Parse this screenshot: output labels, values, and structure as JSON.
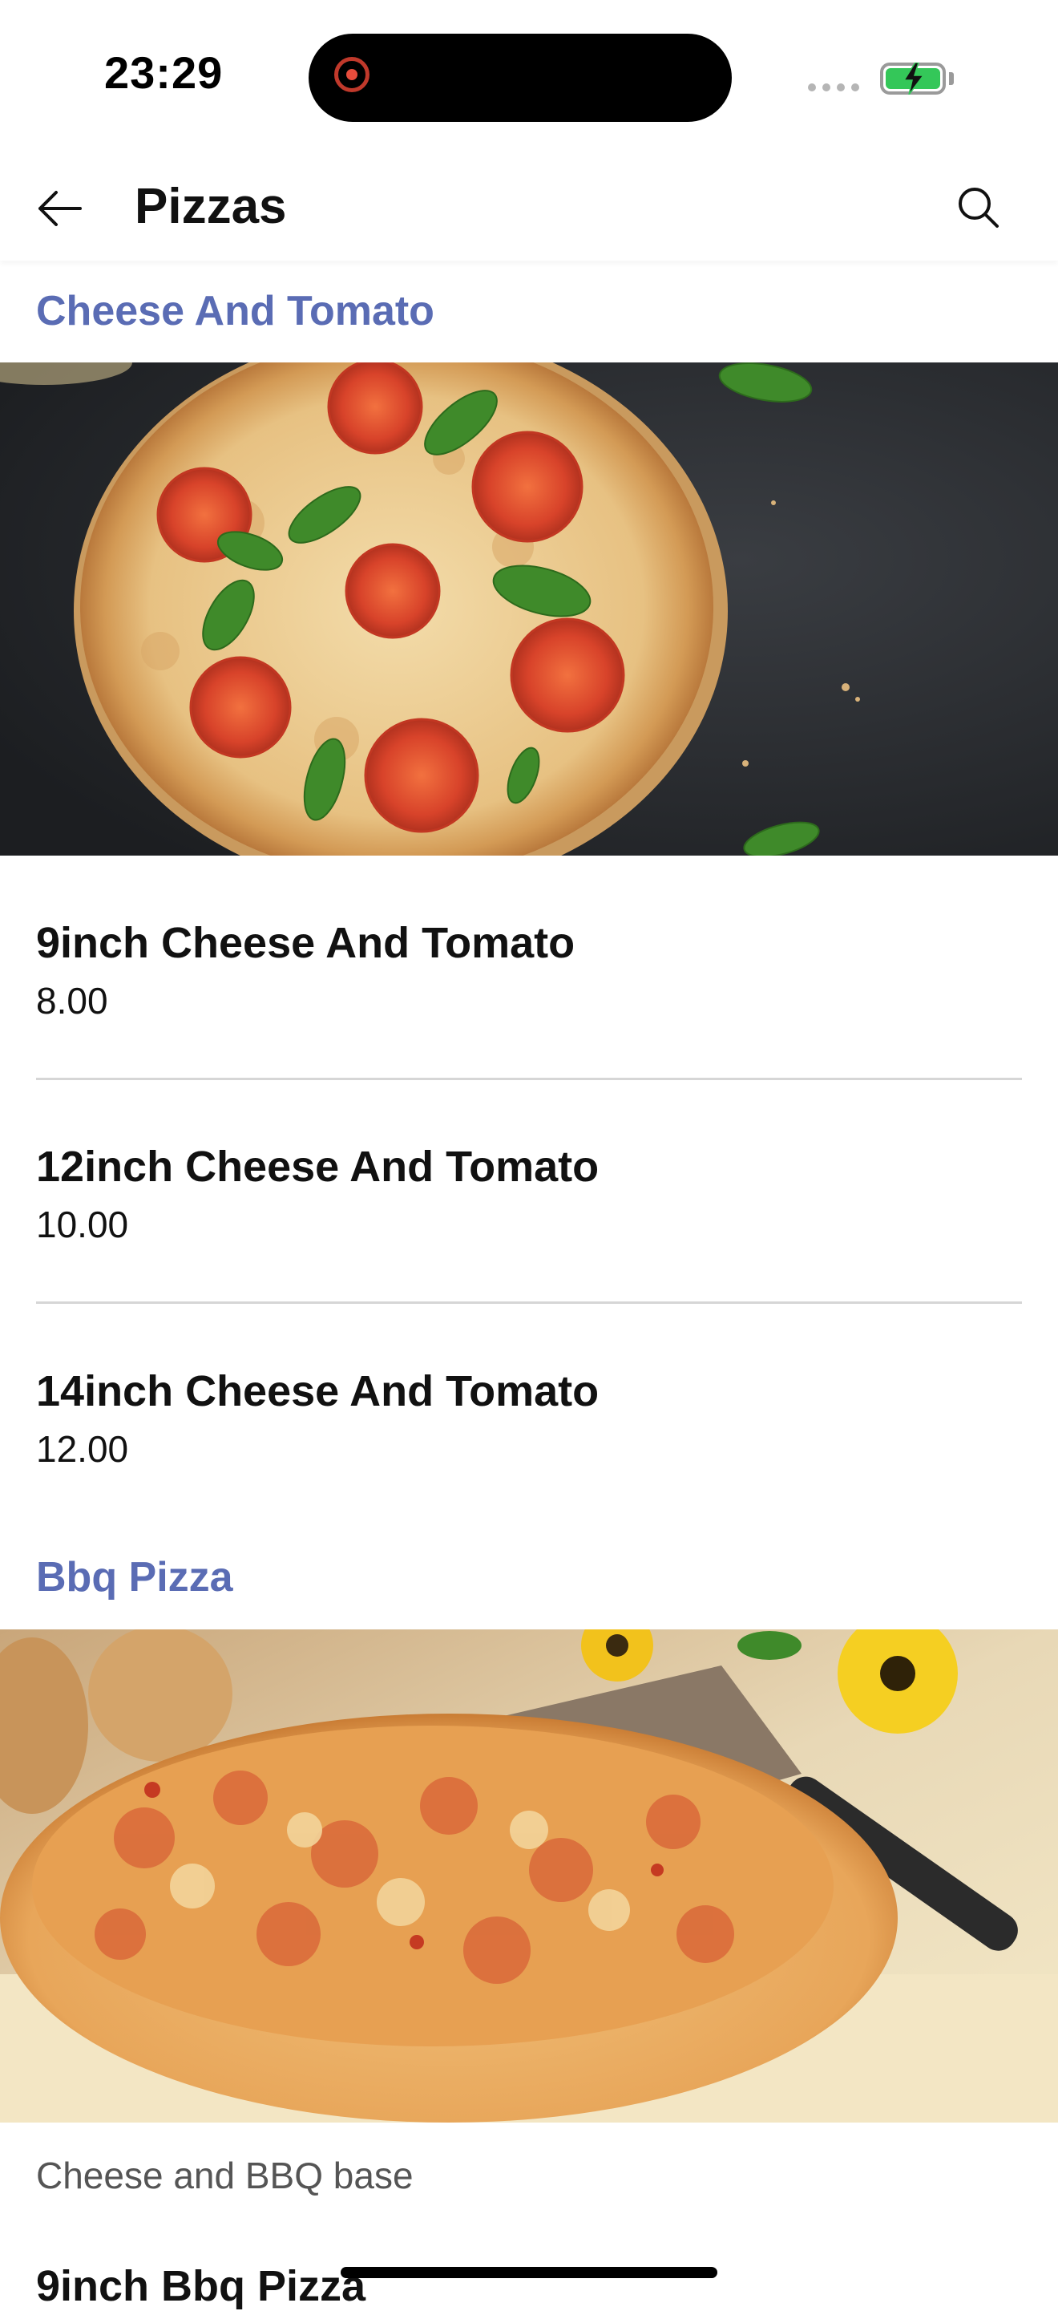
{
  "status_bar": {
    "time": "23:29",
    "battery_color": "#34c759",
    "recording_color": "#e74c3c"
  },
  "header": {
    "title": "Pizzas",
    "back_icon": "arrow-left-icon",
    "search_icon": "search-icon"
  },
  "accent_color": "#5a6cb4",
  "sections": [
    {
      "title": "Cheese And Tomato",
      "image": "cheese-and-tomato-pizza-photo",
      "items": [
        {
          "name": "9inch Cheese And Tomato",
          "price": "8.00"
        },
        {
          "name": "12inch Cheese And Tomato",
          "price": "10.00"
        },
        {
          "name": "14inch Cheese And Tomato",
          "price": "12.00"
        }
      ]
    },
    {
      "title": "Bbq Pizza",
      "image": "bbq-pizza-photo",
      "description": "Cheese and BBQ base",
      "items": [
        {
          "name": "9inch Bbq Pizza"
        }
      ]
    }
  ]
}
